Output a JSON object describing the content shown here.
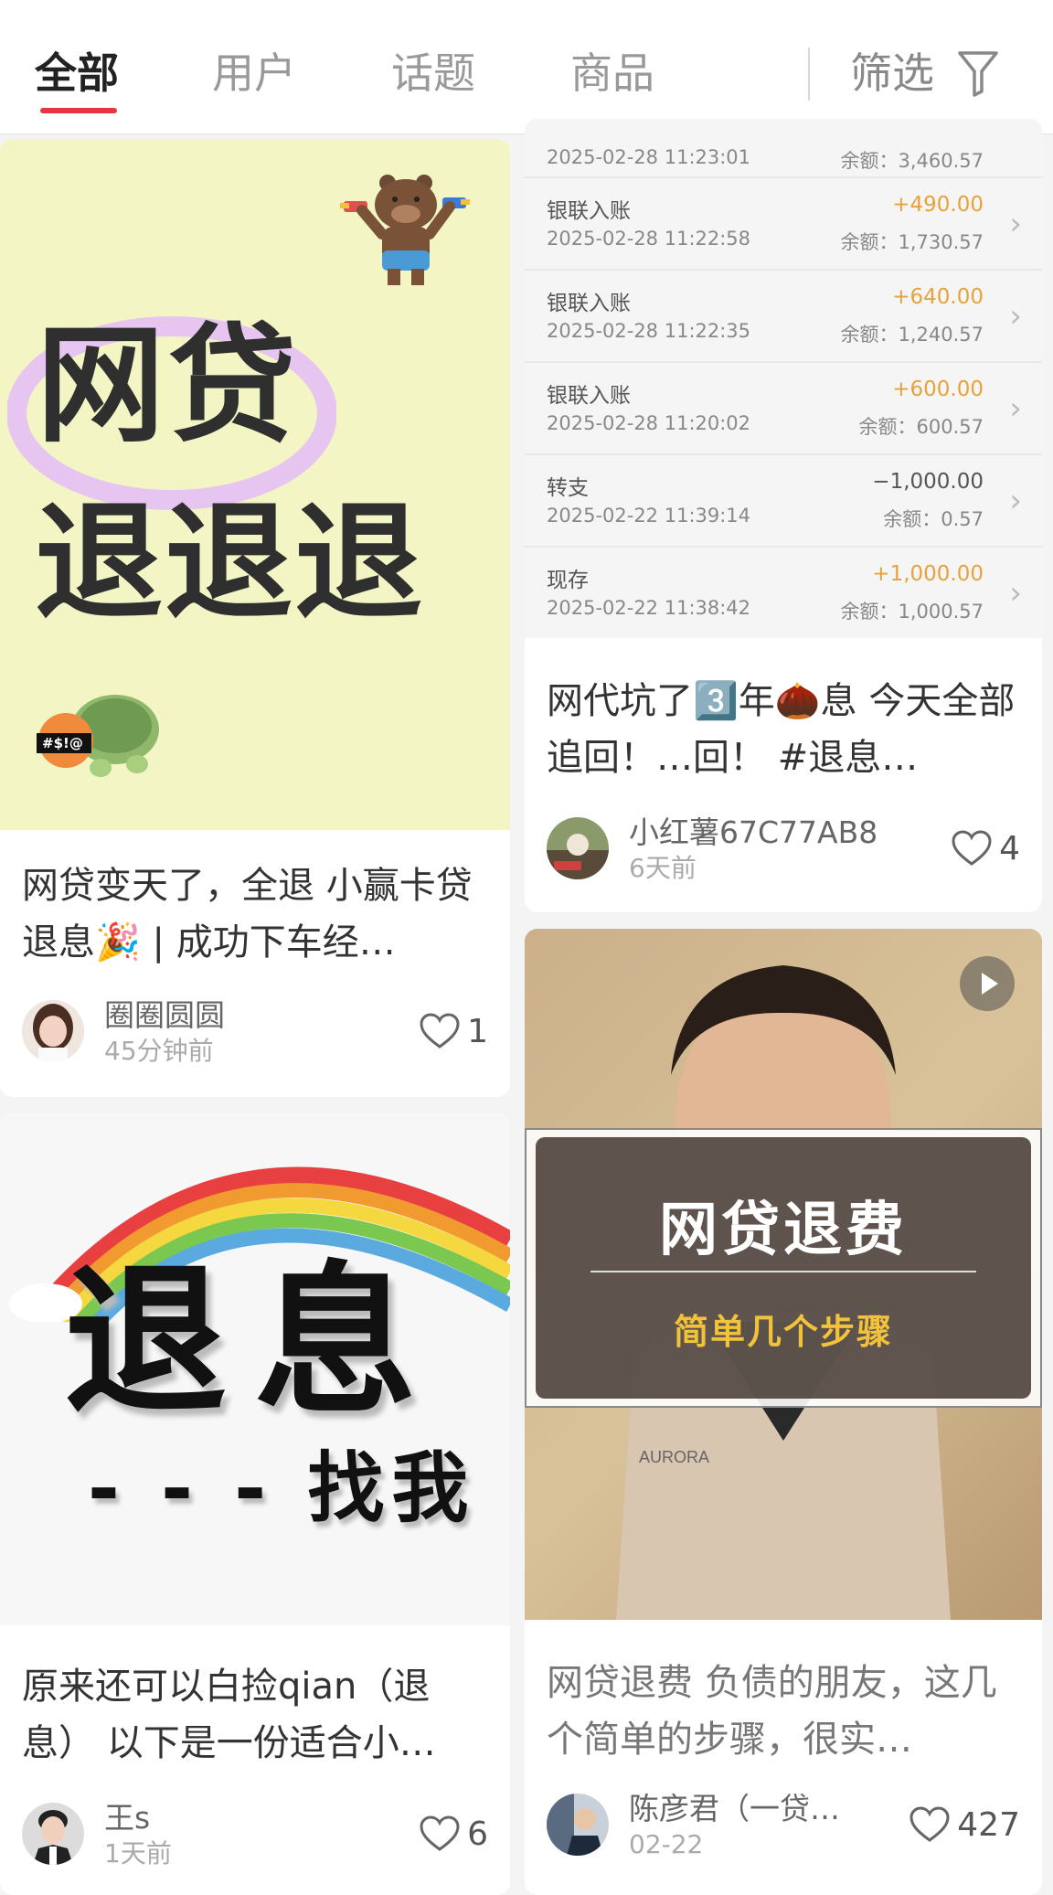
{
  "tabs": [
    {
      "label": "全部",
      "active": true
    },
    {
      "label": "用户",
      "active": false
    },
    {
      "label": "话题",
      "active": false
    },
    {
      "label": "商品",
      "active": false
    }
  ],
  "filter": {
    "label": "筛选",
    "icon": "funnel-icon"
  },
  "colors": {
    "accent": "#e8343c",
    "amount_positive": "#e6a23c",
    "card1_bg": "#f3f6c4"
  },
  "cards": [
    {
      "image": {
        "line1": "网贷",
        "line2": "退退退",
        "turtle_text": "#$!@"
      },
      "title": "网贷变天了，全退 小赢卡贷退息🎉 | 成功下车经…",
      "author": "圈圈圆圆",
      "time": "45分钟前",
      "likes": "1"
    },
    {
      "image": {
        "transactions": [
          {
            "type": "",
            "time": "2025-02-28 11:23:01",
            "amount": "",
            "balance": "余额：3,460.57"
          },
          {
            "type": "银联入账",
            "time": "2025-02-28 11:22:58",
            "amount": "+490.00",
            "balance": "余额：1,730.57"
          },
          {
            "type": "银联入账",
            "time": "2025-02-28 11:22:35",
            "amount": "+640.00",
            "balance": "余额：1,240.57"
          },
          {
            "type": "银联入账",
            "time": "2025-02-28 11:20:02",
            "amount": "+600.00",
            "balance": "余额：600.57"
          },
          {
            "type": "转支",
            "time": "2025-02-22 11:39:14",
            "amount": "−1,000.00",
            "balance": "余额：0.57"
          },
          {
            "type": "现存",
            "time": "2025-02-22 11:38:42",
            "amount": "+1,000.00",
            "balance": "余额：1,000.57"
          }
        ]
      },
      "title": "网代坑了3️⃣年🌰息 今天全部追回！…回！ #退息…",
      "author": "小红薯67C77AB8",
      "time": "6天前",
      "likes": "4"
    },
    {
      "image": {
        "line1": "退息",
        "line2": "- - - 找我"
      },
      "title": "原来还可以白捡qian（退息） 以下是一份适合小…",
      "author": "王s",
      "time": "1天前",
      "likes": "6"
    },
    {
      "image": {
        "overlay_title": "网贷退费",
        "overlay_subtitle": "简单几个步骤",
        "jacket_text": "AURORA"
      },
      "title": "网贷退费 负债的朋友，这几个简单的步骤，很实…",
      "author": "陈彦君（一贷…",
      "time": "02-22",
      "likes": "427"
    }
  ]
}
